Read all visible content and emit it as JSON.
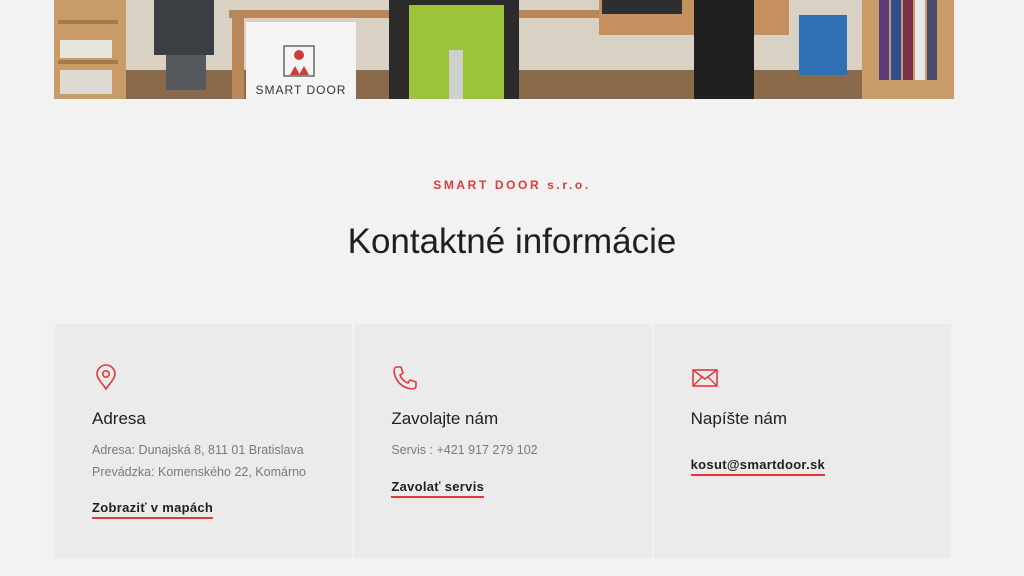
{
  "hero": {
    "logo_text": "SMART DOOR"
  },
  "section": {
    "eyebrow": "SMART DOOR s.r.o.",
    "title": "Kontaktné informácie"
  },
  "cards": {
    "address": {
      "icon": "map-pin-icon",
      "heading": "Adresa",
      "lines": [
        "Adresa: Dunajská 8, 811 01 Bratislava",
        "Prevádzka: Komenského 22, Komárno"
      ],
      "link": "Zobraziť v mapách"
    },
    "phone": {
      "icon": "phone-icon",
      "heading": "Zavolajte nám",
      "lines": [
        "Servis : +421 917 279 102"
      ],
      "link": "Zavolať servis"
    },
    "email": {
      "icon": "envelope-icon",
      "heading": "Napíšte nám",
      "link": "kosut@smartdoor.sk"
    }
  },
  "colors": {
    "accent": "#e0393e",
    "background": "#f2f2f2",
    "card": "#ebebeb"
  }
}
